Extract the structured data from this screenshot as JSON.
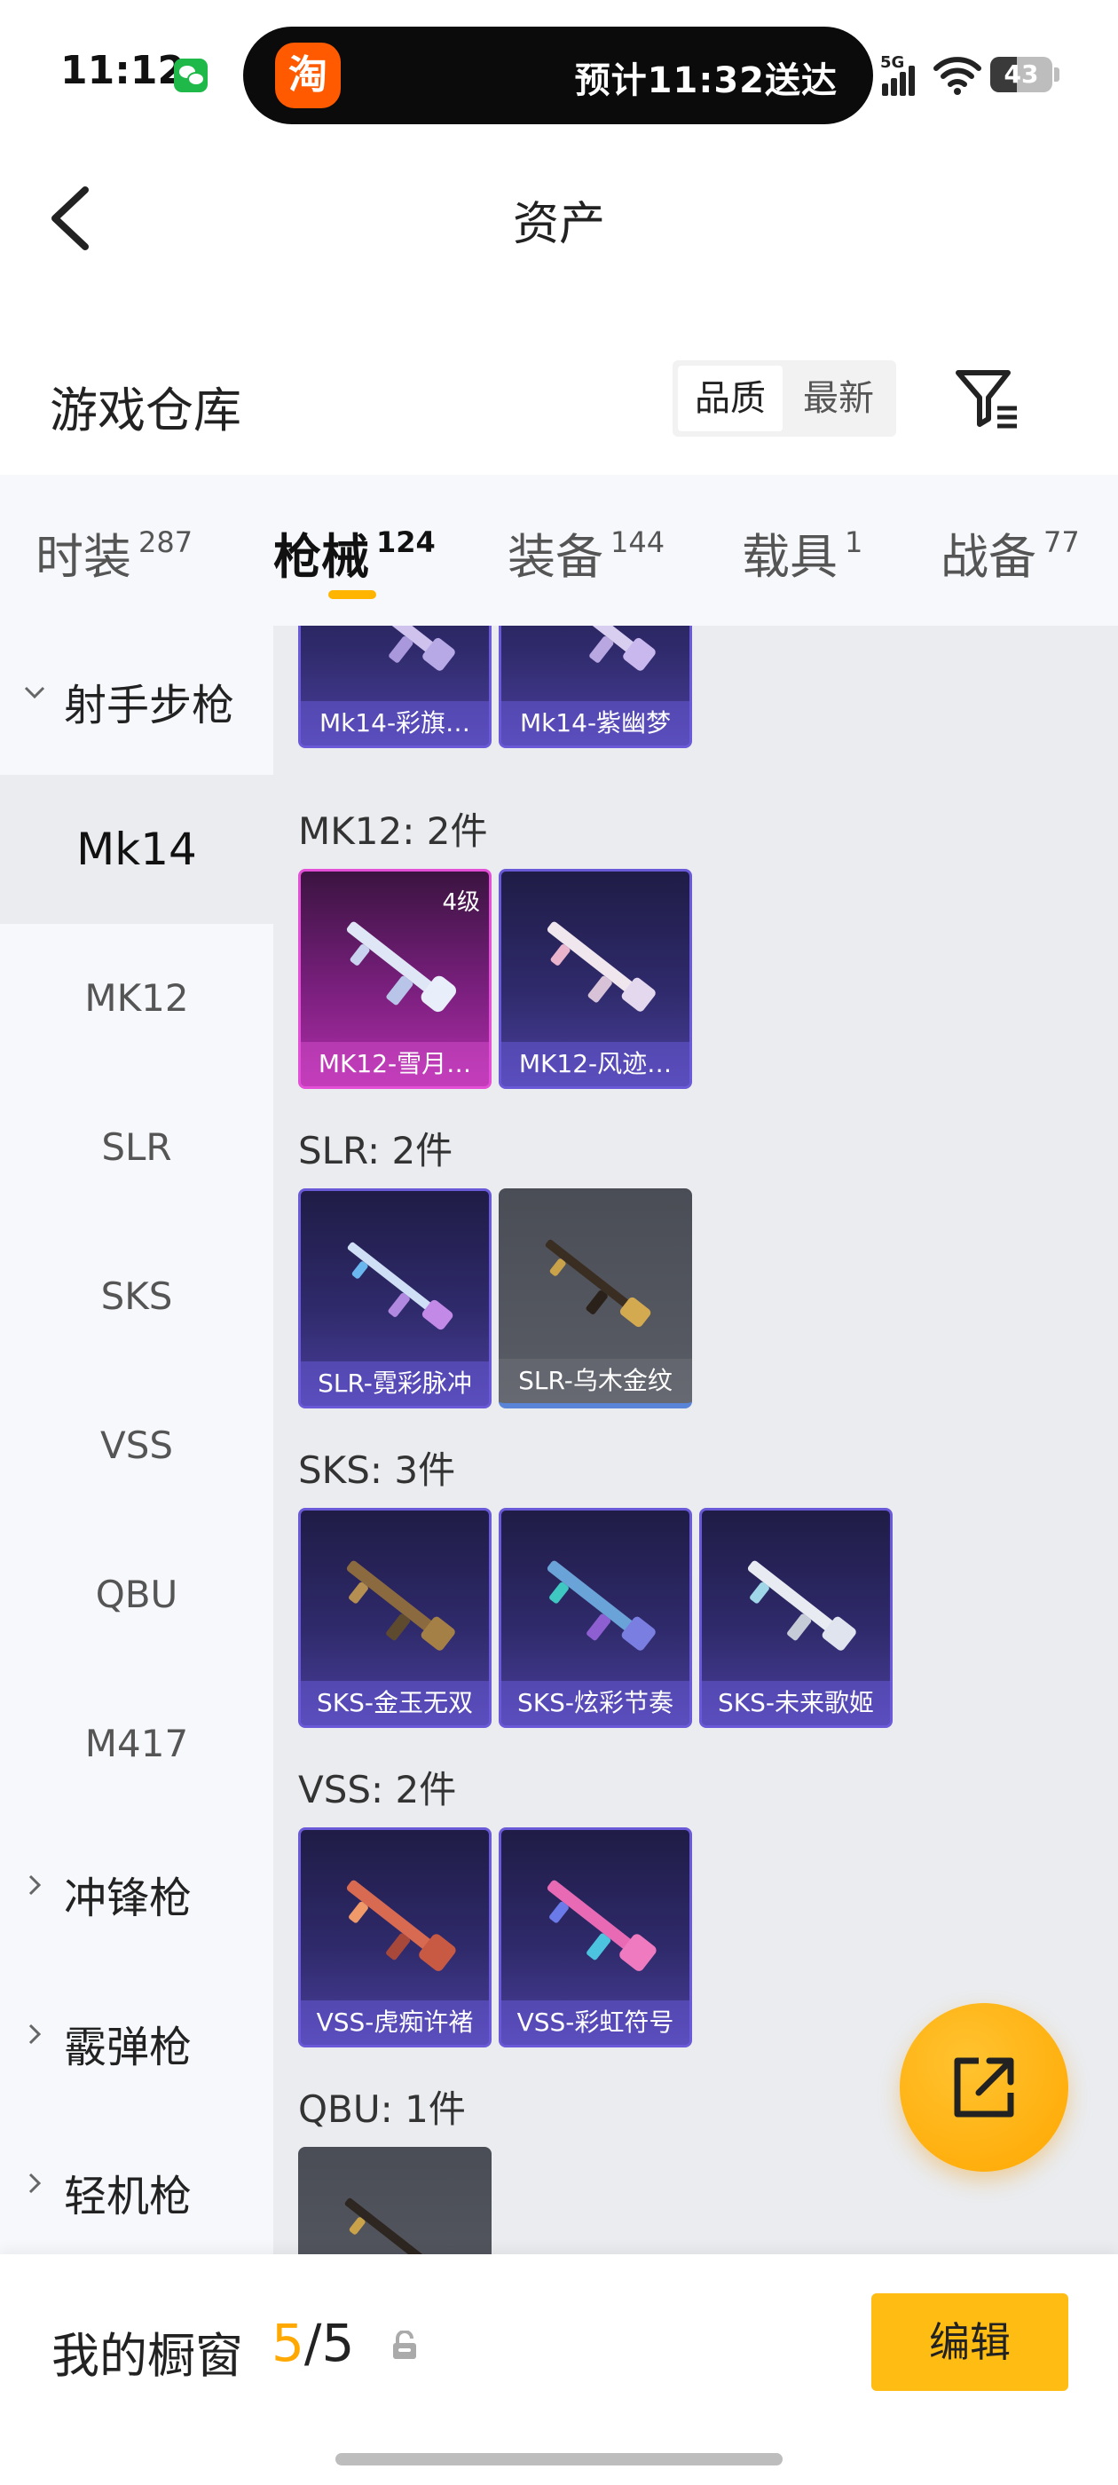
{
  "status_bar": {
    "time": "11:12",
    "island_app_glyph": "淘",
    "island_text": "预计11:32送达",
    "signal_label": "5G",
    "battery": "43"
  },
  "header": {
    "title": "资产"
  },
  "warehouse": {
    "title": "游戏仓库",
    "sort_quality": "品质",
    "sort_newest": "最新"
  },
  "tabs": [
    {
      "label": "时装",
      "count": "287"
    },
    {
      "label": "枪械",
      "count": "124"
    },
    {
      "label": "装备",
      "count": "144"
    },
    {
      "label": "载具",
      "count": "1"
    },
    {
      "label": "战备",
      "count": "77"
    }
  ],
  "sidebar": {
    "groups": [
      {
        "label": "射手步枪"
      },
      {
        "label": "冲锋枪"
      },
      {
        "label": "霰弹枪"
      },
      {
        "label": "轻机枪"
      }
    ],
    "items": [
      {
        "label": "Mk14"
      },
      {
        "label": "MK12"
      },
      {
        "label": "SLR"
      },
      {
        "label": "SKS"
      },
      {
        "label": "VSS"
      },
      {
        "label": "QBU"
      },
      {
        "label": "M417"
      }
    ]
  },
  "sections": [
    {
      "title": "",
      "cards": [
        {
          "name": "Mk14-彩旗…"
        },
        {
          "name": "Mk14-紫幽梦"
        }
      ]
    },
    {
      "title": "MK12: 2件",
      "cards": [
        {
          "name": "MK12-雪月…",
          "level": "4级"
        },
        {
          "name": "MK12-风迹…"
        }
      ]
    },
    {
      "title": "SLR: 2件",
      "cards": [
        {
          "name": "SLR-霓彩脉冲"
        },
        {
          "name": "SLR-乌木金纹"
        }
      ]
    },
    {
      "title": "SKS: 3件",
      "cards": [
        {
          "name": "SKS-金玉无双"
        },
        {
          "name": "SKS-炫彩节奏"
        },
        {
          "name": "SKS-未来歌姬"
        }
      ]
    },
    {
      "title": "VSS: 2件",
      "cards": [
        {
          "name": "VSS-虎痴许褚"
        },
        {
          "name": "VSS-彩虹符号"
        }
      ]
    },
    {
      "title": "QBU: 1件",
      "cards": [
        {
          "name": ""
        }
      ]
    }
  ],
  "bottom": {
    "showcase_label": "我的橱窗",
    "count_current": "5",
    "count_sep": "/",
    "count_total": "5",
    "edit_label": "编辑"
  },
  "colors": {
    "accent": "#ffbd14",
    "count_highlight": "#ffa800",
    "card_purple": "#2f2a6b",
    "card_pink": "#b02ea8",
    "card_grey": "#5a5d66"
  },
  "icons": [
    "back-arrow-icon",
    "filter-icon",
    "share-export-icon",
    "lock-icon",
    "chevron-down-icon",
    "chevron-right-icon",
    "wifi-icon",
    "signal-icon",
    "battery-icon",
    "wechat-icon"
  ]
}
